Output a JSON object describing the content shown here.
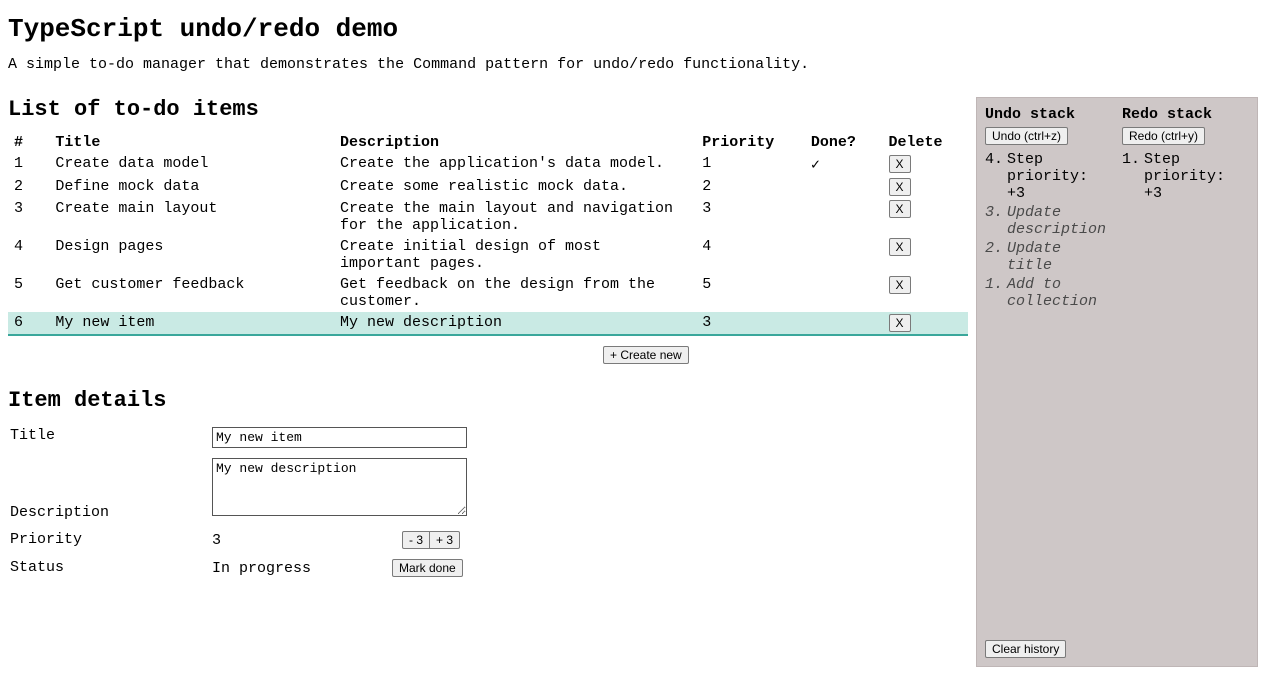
{
  "header": {
    "title": "TypeScript undo/redo demo",
    "subtitle": "A simple to-do manager that demonstrates the Command pattern for undo/redo functionality."
  },
  "list": {
    "heading": "List of to-do items",
    "columns": {
      "num": "#",
      "title": "Title",
      "desc": "Description",
      "priority": "Priority",
      "done": "Done?",
      "del": "Delete"
    },
    "delete_label": "X",
    "done_glyph": "✓",
    "create_label": "+ Create new",
    "items": [
      {
        "num": "1",
        "title": "Create data model",
        "desc": "Create the application's data model.",
        "priority": "1",
        "done": true,
        "selected": false
      },
      {
        "num": "2",
        "title": "Define mock data",
        "desc": "Create some realistic mock data.",
        "priority": "2",
        "done": false,
        "selected": false
      },
      {
        "num": "3",
        "title": "Create main layout",
        "desc": "Create the main layout and navigation for the application.",
        "priority": "3",
        "done": false,
        "selected": false
      },
      {
        "num": "4",
        "title": "Design pages",
        "desc": "Create initial design of most important pages.",
        "priority": "4",
        "done": false,
        "selected": false
      },
      {
        "num": "5",
        "title": "Get customer feedback",
        "desc": "Get feedback on the design from the customer.",
        "priority": "5",
        "done": false,
        "selected": false
      },
      {
        "num": "6",
        "title": "My new item",
        "desc": "My new description",
        "priority": "3",
        "done": false,
        "selected": true
      }
    ]
  },
  "details": {
    "heading": "Item details",
    "labels": {
      "title": "Title",
      "desc": "Description",
      "priority": "Priority",
      "status": "Status"
    },
    "title_value": "My new item",
    "desc_value": "My new description",
    "priority_value": "3",
    "priority_down_label": "- 3",
    "priority_up_label": "+ 3",
    "status_value": "In progress",
    "mark_done_label": "Mark done"
  },
  "sidebar": {
    "undo": {
      "heading": "Undo stack",
      "button": "Undo (ctrl+z)"
    },
    "redo": {
      "heading": "Redo stack",
      "button": "Redo (ctrl+y)"
    },
    "undo_items": [
      {
        "num": "4.",
        "text": "Step priority: +3",
        "dim": false
      },
      {
        "num": "3.",
        "text": "Update description",
        "dim": true
      },
      {
        "num": "2.",
        "text": "Update title",
        "dim": true
      },
      {
        "num": "1.",
        "text": "Add to collection",
        "dim": true
      }
    ],
    "redo_items": [
      {
        "num": "1.",
        "text": "Step priority: +3",
        "dim": false
      }
    ],
    "clear_label": "Clear history"
  }
}
